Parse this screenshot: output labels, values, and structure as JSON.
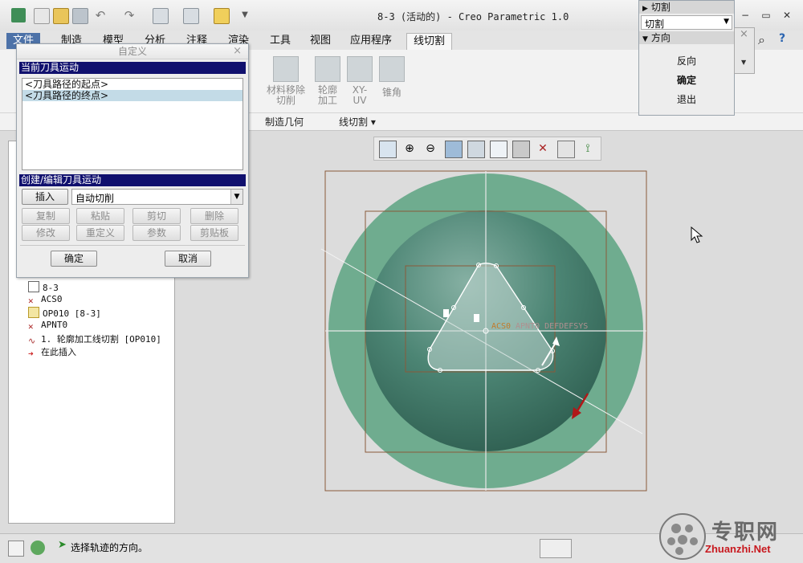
{
  "window": {
    "title": "8-3 (活动的) - Creo Parametric 1.0",
    "minimize_glyph": "−",
    "restore_glyph": "▭",
    "close_glyph": "✕"
  },
  "ribbon": {
    "tabs": [
      "文件",
      "制造",
      "模型",
      "分析",
      "注释",
      "渲染",
      "工具",
      "视图",
      "应用程序",
      "线切割"
    ],
    "active_tab": "线切割",
    "buttons": [
      {
        "label": "材料移除切削"
      },
      {
        "label": "轮廓加工"
      },
      {
        "label": "XY-UV"
      },
      {
        "label": "锥角"
      }
    ],
    "groups": [
      "制造几何",
      "线切割 ▾"
    ]
  },
  "model_tree": {
    "items": [
      {
        "label": "8-3",
        "icon": "part-icon"
      },
      {
        "label": "ACS0",
        "icon": "csys-icon"
      },
      {
        "label": "OP010 [8-3]",
        "icon": "operation-icon"
      },
      {
        "label": "APNT0",
        "icon": "point-icon"
      },
      {
        "label": "1. 轮廓加工线切割 [OP010]",
        "icon": "wire-cut-icon"
      },
      {
        "label": "在此插入",
        "icon": "insert-arrow-icon"
      }
    ]
  },
  "dialog": {
    "title": "自定义",
    "close_glyph": "×",
    "section1": "当前刀具运动",
    "list_items": [
      {
        "label": "<刀具路径的起点>",
        "selected": false
      },
      {
        "label": "<刀具路径的终点>",
        "selected": true
      }
    ],
    "section2": "创建/编辑刀具运动",
    "insert_label": "插入",
    "mode_value": "自动切削",
    "edit_buttons": [
      "复制",
      "粘贴",
      "剪切",
      "删除",
      "修改",
      "重定义",
      "参数",
      "剪贴板"
    ],
    "ok_label": "确定",
    "cancel_label": "取消"
  },
  "menu_manager": {
    "header1": "切割",
    "dropdown_value": "切割",
    "header2": "方向",
    "items": [
      "反向",
      "确定",
      "退出"
    ],
    "close_glyph": "×"
  },
  "graphics": {
    "csys_label": "ACS0",
    "overlay_label": "APNT0 DEFDEFSYS"
  },
  "status_bar": {
    "message": "选择轨迹的方向。"
  },
  "watermark": {
    "cn": "专职网",
    "url": "Zhuanzhi.Net"
  },
  "colors": {
    "model_outer": "#6fac8f",
    "model_inner": "#3f7566",
    "sketch_frame": "#8a5a3a",
    "section_bar": "#10106e",
    "selected_row": "#c3dbe7",
    "direction_arrow": "#b01818"
  }
}
